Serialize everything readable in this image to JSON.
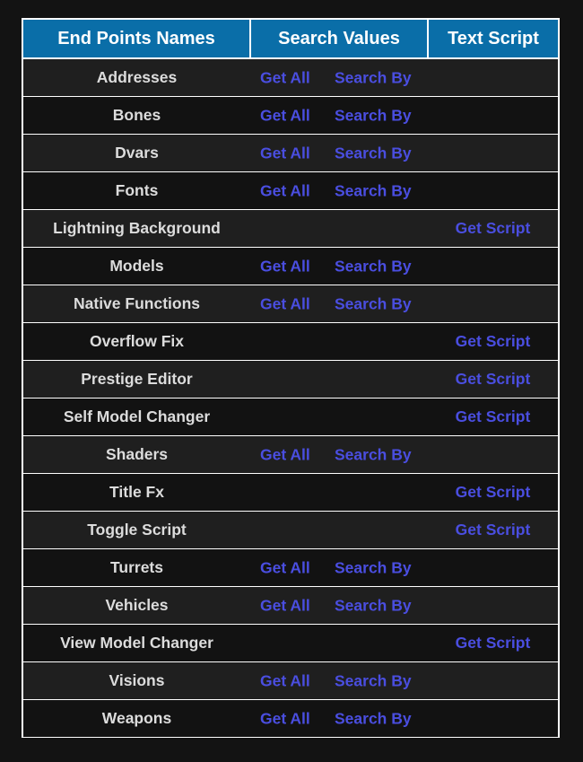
{
  "table": {
    "headers": [
      "End Points Names",
      "Search Values",
      "Text Script"
    ],
    "rows": [
      {
        "name": "Addresses",
        "get_all": "Get All",
        "search_by": "Search By",
        "script": ""
      },
      {
        "name": "Bones",
        "get_all": "Get All",
        "search_by": "Search By",
        "script": ""
      },
      {
        "name": "Dvars",
        "get_all": "Get All",
        "search_by": "Search By",
        "script": ""
      },
      {
        "name": "Fonts",
        "get_all": "Get All",
        "search_by": "Search By",
        "script": ""
      },
      {
        "name": "Lightning Background",
        "get_all": "",
        "search_by": "",
        "script": "Get Script"
      },
      {
        "name": "Models",
        "get_all": "Get All",
        "search_by": "Search By",
        "script": ""
      },
      {
        "name": "Native Functions",
        "get_all": "Get All",
        "search_by": "Search By",
        "script": ""
      },
      {
        "name": "Overflow Fix",
        "get_all": "",
        "search_by": "",
        "script": "Get Script"
      },
      {
        "name": "Prestige Editor",
        "get_all": "",
        "search_by": "",
        "script": "Get Script"
      },
      {
        "name": "Self Model Changer",
        "get_all": "",
        "search_by": "",
        "script": "Get Script"
      },
      {
        "name": "Shaders",
        "get_all": "Get All",
        "search_by": "Search By",
        "script": ""
      },
      {
        "name": "Title Fx",
        "get_all": "",
        "search_by": "",
        "script": "Get Script"
      },
      {
        "name": "Toggle Script",
        "get_all": "",
        "search_by": "",
        "script": "Get Script"
      },
      {
        "name": "Turrets",
        "get_all": "Get All",
        "search_by": "Search By",
        "script": ""
      },
      {
        "name": "Vehicles",
        "get_all": "Get All",
        "search_by": "Search By",
        "script": ""
      },
      {
        "name": "View Model Changer",
        "get_all": "",
        "search_by": "",
        "script": "Get Script"
      },
      {
        "name": "Visions",
        "get_all": "Get All",
        "search_by": "Search By",
        "script": ""
      },
      {
        "name": "Weapons",
        "get_all": "Get All",
        "search_by": "Search By",
        "script": ""
      }
    ]
  },
  "colors": {
    "header_bg": "#0a6ea8",
    "link": "#4a4ee0",
    "row_odd": "#1f1f1f",
    "row_even": "#121212",
    "page_bg": "#131313"
  }
}
